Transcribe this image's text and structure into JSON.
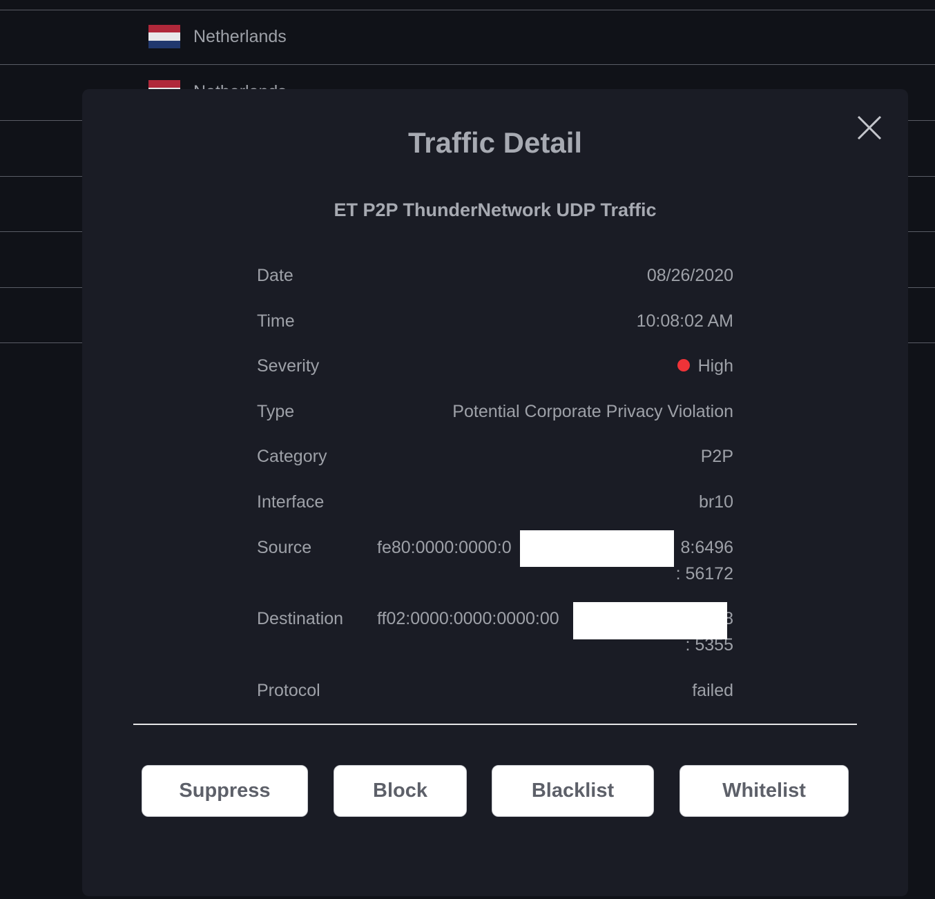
{
  "background": {
    "rows": [
      {
        "country": "Netherlands"
      },
      {
        "country": "Netherlands"
      }
    ]
  },
  "modal": {
    "title": "Traffic Detail",
    "subtitle": "ET P2P ThunderNetwork UDP Traffic",
    "fields": {
      "date": {
        "label": "Date",
        "value": "08/26/2020"
      },
      "time": {
        "label": "Time",
        "value": "10:08:02 AM"
      },
      "severity": {
        "label": "Severity",
        "value": "High",
        "color": "#ef3338"
      },
      "type": {
        "label": "Type",
        "value": "Potential Corporate Privacy Violation"
      },
      "category": {
        "label": "Category",
        "value": "P2P"
      },
      "interface": {
        "label": "Interface",
        "value": "br10"
      },
      "source": {
        "label": "Source",
        "address_start": "fe80:0000:0000:0",
        "address_end": "8:6496",
        "port": ": 56172"
      },
      "destination": {
        "label": "Destination",
        "address_start": "ff02:0000:0000:0000:00",
        "address_end": "8",
        "port": ": 5355"
      },
      "protocol": {
        "label": "Protocol",
        "value": "failed"
      }
    },
    "buttons": {
      "suppress": "Suppress",
      "block": "Block",
      "blacklist": "Blacklist",
      "whitelist": "Whitelist"
    }
  }
}
